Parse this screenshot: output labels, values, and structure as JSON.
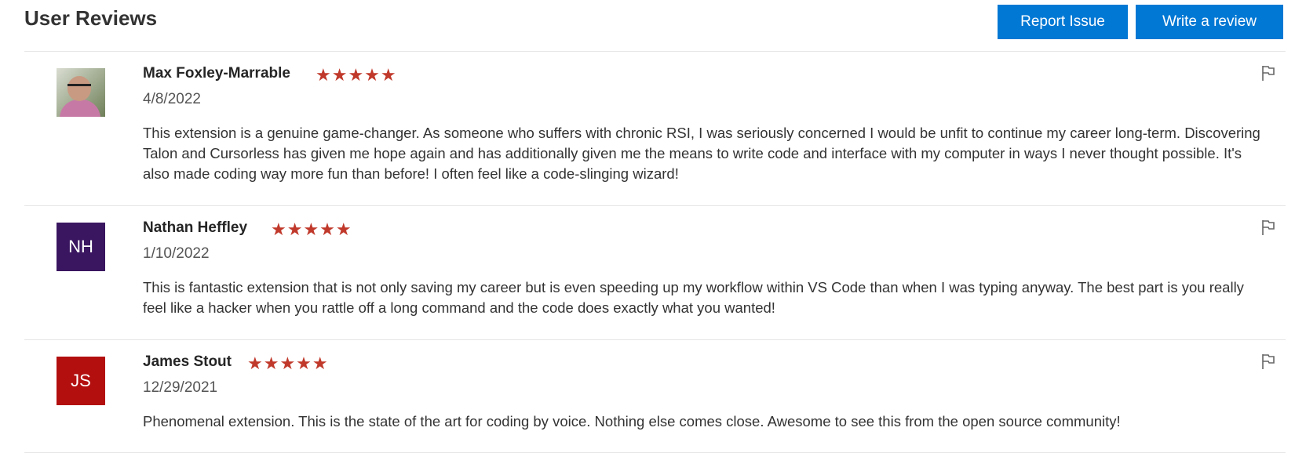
{
  "header": {
    "title": "User Reviews",
    "report_label": "Report Issue",
    "write_label": "Write a review"
  },
  "colors": {
    "accent": "#0078d4",
    "star": "#c0392b",
    "avatar_nh": "#3a1660",
    "avatar_js": "#b30f0f"
  },
  "reviews": [
    {
      "name": "Max Foxley-Marrable",
      "rating": 5,
      "stars": "★★★★★",
      "date": "4/8/2022",
      "text": "This extension is a genuine game-changer. As someone who suffers with chronic RSI, I was seriously concerned I would be unfit to continue my career long-term. Discovering Talon and Cursorless has given me hope again and has additionally given me the means to write code and interface with my computer in ways I never thought possible. It's also made coding way more fun than before! I often feel like a code-slinging wizard!",
      "icon": "flag-icon"
    },
    {
      "name": "Nathan Heffley",
      "rating": 5,
      "stars": "★★★★★",
      "date": "1/10/2022",
      "initials": "NH",
      "text": "This is fantastic extension that is not only saving my career but is even speeding up my workflow within VS Code than when I was typing anyway. The best part is you really feel like a hacker when you rattle off a long command and the code does exactly what you wanted!",
      "icon": "flag-icon"
    },
    {
      "name": "James Stout",
      "rating": 5,
      "stars": "★★★★★",
      "date": "12/29/2021",
      "initials": "JS",
      "text": "Phenomenal extension. This is the state of the art for coding by voice. Nothing else comes close. Awesome to see this from the open source community!",
      "icon": "flag-icon"
    }
  ]
}
